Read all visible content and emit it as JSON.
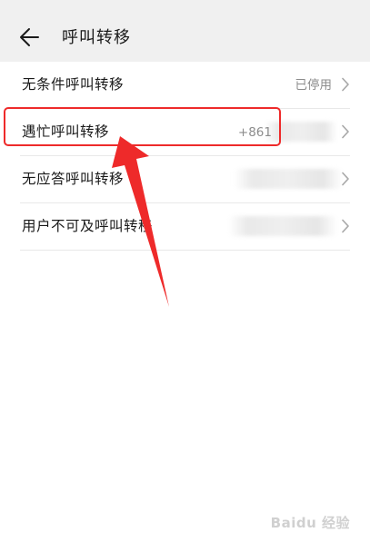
{
  "header": {
    "title": "呼叫转移",
    "back_icon": "back-arrow-icon"
  },
  "rows": [
    {
      "label": "无条件呼叫转移",
      "value": "已停用"
    },
    {
      "label": "遇忙呼叫转移",
      "value": "+861"
    },
    {
      "label": "无应答呼叫转移",
      "value": ""
    },
    {
      "label": "用户不可及呼叫转移",
      "value": ""
    }
  ],
  "colors": {
    "highlight": "#ee2a2a",
    "header_bg": "#f0f0f0",
    "text": "#1a1a1a",
    "secondary_text": "#8c8c8c"
  },
  "watermark": "Baidu 经验"
}
